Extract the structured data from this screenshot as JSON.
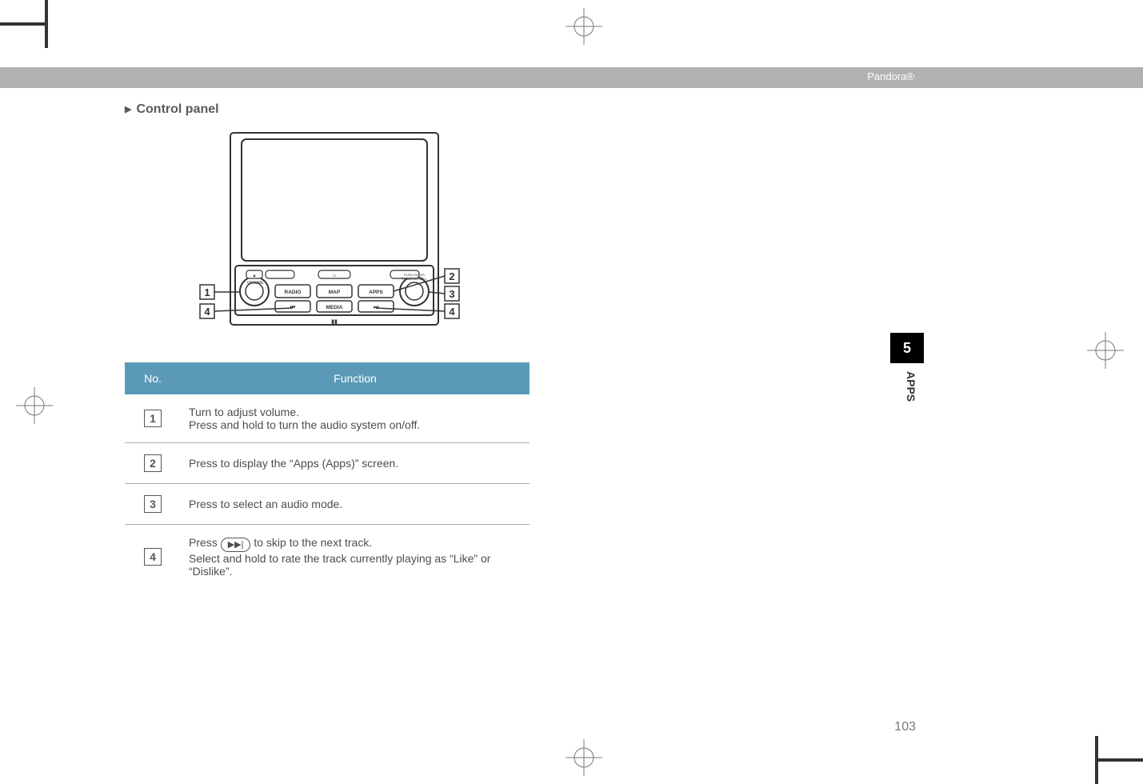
{
  "breadcrumb": "Pandora®",
  "section_title": "Control panel",
  "thumb": {
    "number": "5",
    "label": "APPS"
  },
  "page_number": "103",
  "table": {
    "headers": {
      "no": "No.",
      "func": "Function"
    },
    "rows": [
      {
        "num": "1",
        "func_line1": "Turn to adjust volume.",
        "func_line2": "Press and hold to turn the audio system on/off."
      },
      {
        "num": "2",
        "func_line1": "Press to display the “Apps (Apps)” screen.",
        "func_line2": ""
      },
      {
        "num": "3",
        "func_line1": "Press to select an audio mode.",
        "func_line2": ""
      },
      {
        "num": "4",
        "func_prefix": "Press ",
        "func_btn": "▶▶|",
        "func_after": " to skip to the next track.",
        "func_line2": "Select and hold to rate the track currently playing as “Like” or “Dislike”."
      }
    ]
  },
  "panel_labels": {
    "radio": "RADIO",
    "map": "MAP",
    "apps": "APPS",
    "media": "MEDIA",
    "volume": "VOLUME",
    "tune": "TUNE/SCROLL",
    "push_enter": "PUSH ENTER"
  }
}
